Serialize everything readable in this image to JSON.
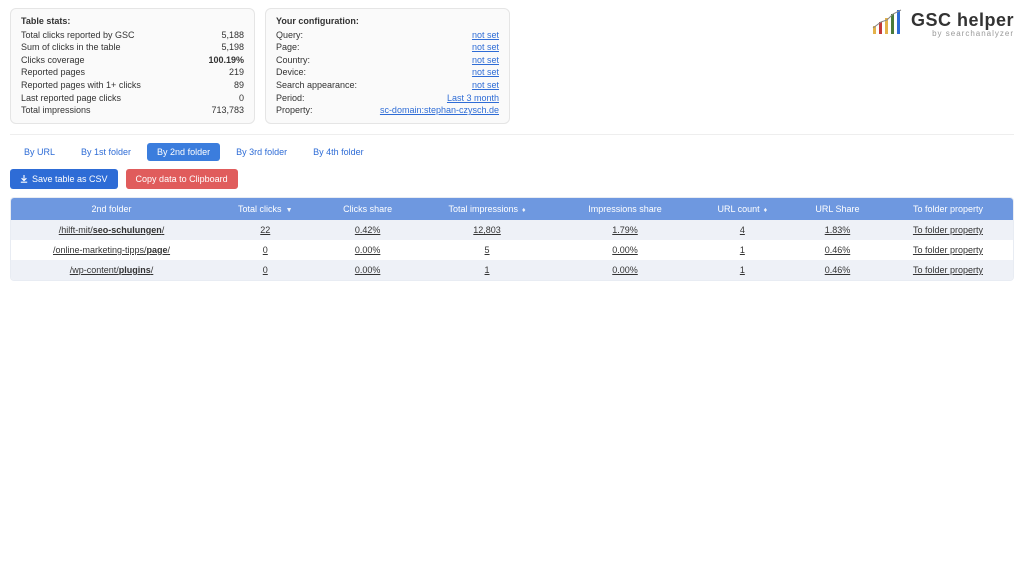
{
  "logo": {
    "name": "GSC helper",
    "sub": "by searchanalyzer"
  },
  "stats_card": {
    "title": "Table stats:",
    "rows": [
      {
        "label": "Total clicks reported by GSC",
        "value": "5,188"
      },
      {
        "label": "Sum of clicks in the table",
        "value": "5,198"
      },
      {
        "label": "Clicks coverage",
        "value": "100.19%",
        "bold": true
      },
      {
        "label": "Reported pages",
        "value": "219"
      },
      {
        "label": "Reported pages with 1+ clicks",
        "value": "89"
      },
      {
        "label": "Last reported page clicks",
        "value": "0"
      },
      {
        "label": "Total impressions",
        "value": "713,783"
      }
    ]
  },
  "config_card": {
    "title": "Your configuration:",
    "rows": [
      {
        "label": "Query:",
        "value": "not set"
      },
      {
        "label": "Page:",
        "value": "not set"
      },
      {
        "label": "Country:",
        "value": "not set"
      },
      {
        "label": "Device:",
        "value": "not set"
      },
      {
        "label": "Search appearance:",
        "value": "not set"
      },
      {
        "label": "Period:",
        "value": "Last 3 month"
      },
      {
        "label": "Property:",
        "value": "sc-domain:stephan-czysch.de"
      }
    ]
  },
  "tabs": [
    {
      "label": "By URL",
      "active": false
    },
    {
      "label": "By 1st folder",
      "active": false
    },
    {
      "label": "By 2nd folder",
      "active": true
    },
    {
      "label": "By 3rd folder",
      "active": false
    },
    {
      "label": "By 4th folder",
      "active": false
    }
  ],
  "buttons": {
    "save_csv": "Save table as CSV",
    "copy_clip": "Copy data to Clipboard"
  },
  "table": {
    "columns": [
      {
        "label": "2nd folder",
        "sort": ""
      },
      {
        "label": "Total clicks",
        "sort": "▼"
      },
      {
        "label": "Clicks share",
        "sort": ""
      },
      {
        "label": "Total impressions",
        "sort": "♦"
      },
      {
        "label": "Impressions share",
        "sort": ""
      },
      {
        "label": "URL count",
        "sort": "♦"
      },
      {
        "label": "URL Share",
        "sort": ""
      },
      {
        "label": "To folder property",
        "sort": ""
      }
    ],
    "rows": [
      {
        "folder_pre": "/hilft-mit/",
        "folder_bold": "seo-schulungen",
        "folder_post": "/",
        "clicks": "22",
        "clicks_share": "0.42%",
        "impressions": "12,803",
        "impr_share": "1.79%",
        "url_count": "4",
        "url_share": "1.83%",
        "to_prop": "To folder property"
      },
      {
        "folder_pre": "/online-marketing-tipps/",
        "folder_bold": "page",
        "folder_post": "/",
        "clicks": "0",
        "clicks_share": "0.00%",
        "impressions": "5",
        "impr_share": "0.00%",
        "url_count": "1",
        "url_share": "0.46%",
        "to_prop": "To folder property"
      },
      {
        "folder_pre": "/wp-content/",
        "folder_bold": "plugins",
        "folder_post": "/",
        "clicks": "0",
        "clicks_share": "0.00%",
        "impressions": "1",
        "impr_share": "0.00%",
        "url_count": "1",
        "url_share": "0.46%",
        "to_prop": "To folder property"
      }
    ]
  }
}
